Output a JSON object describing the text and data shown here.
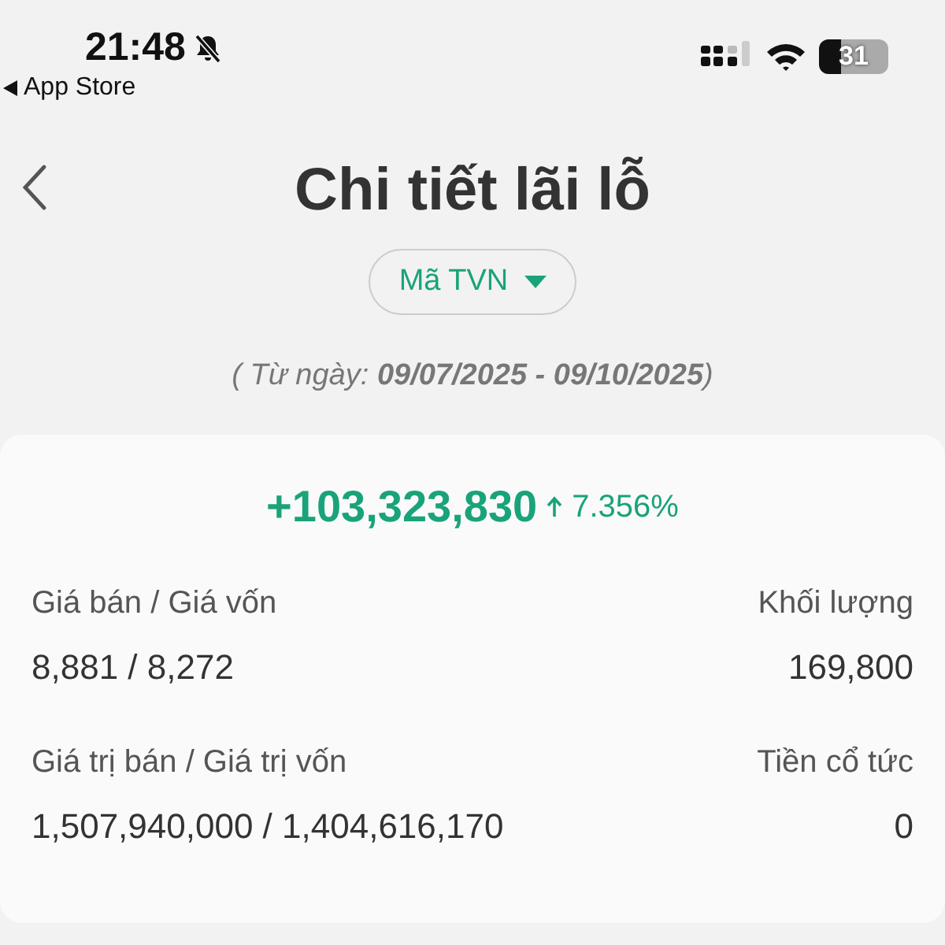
{
  "status_bar": {
    "time": "21:48",
    "silent": true,
    "back_app": "App Store",
    "battery": "31"
  },
  "header": {
    "title": "Chi tiết lãi lỗ"
  },
  "filter": {
    "label": "Mã TVN"
  },
  "date_range": "( Từ ngày: **09/07/2025 - 09/10/2025**)",
  "summary": {
    "profit": "+103,323,830",
    "percent": "7.356%",
    "fields": [
      {
        "label": "Giá bán / Giá vốn",
        "value": "8,881 / 8,272"
      },
      {
        "label": "Khối lượng",
        "value": "169,800"
      },
      {
        "label": "Giá trị bán / Giá trị vốn",
        "value": "1,507,940,000 / 1,404,616,170"
      },
      {
        "label": "Tiền cổ tức",
        "value": "0"
      }
    ]
  }
}
